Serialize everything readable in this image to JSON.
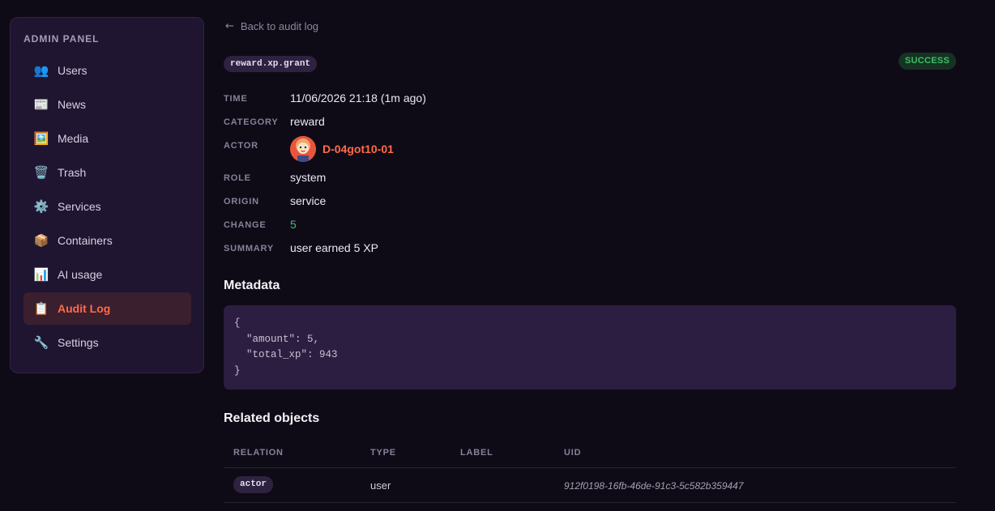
{
  "sidebar": {
    "title": "ADMIN PANEL",
    "items": [
      {
        "label": "Users",
        "icon": "👥",
        "icon_name": "users-icon"
      },
      {
        "label": "News",
        "icon": "📰",
        "icon_name": "newspaper-icon"
      },
      {
        "label": "Media",
        "icon": "🖼️",
        "icon_name": "image-icon"
      },
      {
        "label": "Trash",
        "icon": "🗑️",
        "icon_name": "trash-icon"
      },
      {
        "label": "Services",
        "icon": "⚙️",
        "icon_name": "gear-icon"
      },
      {
        "label": "Containers",
        "icon": "📦",
        "icon_name": "package-icon"
      },
      {
        "label": "AI usage",
        "icon": "📊",
        "icon_name": "bar-chart-icon"
      },
      {
        "label": "Audit Log",
        "icon": "📋",
        "icon_name": "clipboard-icon",
        "active": true
      },
      {
        "label": "Settings",
        "icon": "🔧",
        "icon_name": "wrench-icon"
      }
    ]
  },
  "back_link": {
    "arrow": "←",
    "label": "Back to audit log"
  },
  "event": {
    "action": "reward.xp.grant",
    "status": "SUCCESS",
    "fields": {
      "time_label": "TIME",
      "time_value": "11/06/2026 21:18 (1m ago)",
      "category_label": "CATEGORY",
      "category_value": "reward",
      "actor_label": "ACTOR",
      "actor_value": "D-04got10-01",
      "role_label": "ROLE",
      "role_value": "system",
      "origin_label": "ORIGIN",
      "origin_value": "service",
      "change_label": "CHANGE",
      "change_value": "5",
      "summary_label": "SUMMARY",
      "summary_value": "user earned 5 XP"
    }
  },
  "metadata": {
    "title": "Metadata",
    "json_text": "{\n  \"amount\": 5,\n  \"total_xp\": 943\n}"
  },
  "related": {
    "title": "Related objects",
    "columns": [
      "RELATION",
      "TYPE",
      "LABEL",
      "UID"
    ],
    "rows": [
      {
        "relation": "actor",
        "type": "user",
        "label": "",
        "uid": "912f0198-16fb-46de-91c3-5c582b359447"
      }
    ]
  },
  "colors": {
    "accent": "#ff6b4a",
    "success": "#3fbf6a",
    "background": "#0f0b16",
    "panel": "#1f1530"
  }
}
